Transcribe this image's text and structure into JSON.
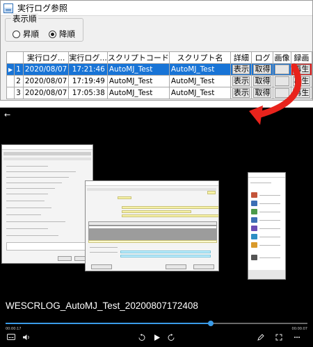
{
  "dialog": {
    "title": "実行ログ参照",
    "sort_group": {
      "title": "表示順",
      "ascending": "昇順",
      "descending": "降順",
      "selected": "descending"
    },
    "table": {
      "headers": [
        "",
        "実行ログ...",
        "実行ログ...",
        "スクリプトコード",
        "スクリプト名",
        "詳細",
        "ログ",
        "画像",
        "録画"
      ],
      "rows": [
        {
          "indicator": "▶",
          "no": "1",
          "date": "2020/08/07",
          "time": "17:21:46",
          "code": "AutoMJ_Test",
          "name": "AutoMJ_Test",
          "detail": "表示",
          "log": "取得",
          "image": "",
          "video": "再生",
          "selected": true
        },
        {
          "indicator": "",
          "no": "2",
          "date": "2020/08/07",
          "time": "17:19:49",
          "code": "AutoMJ_Test",
          "name": "AutoMJ_Test",
          "detail": "表示",
          "log": "取得",
          "image": "",
          "video": "再生",
          "selected": false
        },
        {
          "indicator": "",
          "no": "3",
          "date": "2020/08/07",
          "time": "17:05:38",
          "code": "AutoMJ_Test",
          "name": "AutoMJ_Test",
          "detail": "表示",
          "log": "取得",
          "image": "",
          "video": "再生",
          "selected": false
        }
      ]
    }
  },
  "colors": {
    "selection": "#1874d6",
    "highlight": "#e01818",
    "arrow": "#e8231c",
    "seek": "#3a9be8"
  },
  "player": {
    "back_icon": "back-arrow-icon",
    "caption": "WESCRLOG_AutoMJ_Test_20200807172408",
    "time_elapsed": "00:00:17",
    "time_total": "00:00:07",
    "progress_fraction": 0.68,
    "controls": {
      "subtitles_icon": "subtitles-icon",
      "volume_icon": "volume-icon",
      "rewind_icon": "rewind-10-icon",
      "play_icon": "play-icon",
      "forward_icon": "forward-30-icon",
      "edit_icon": "edit-pen-icon",
      "fullscreen_icon": "fullscreen-icon",
      "more_icon": "more-icon"
    }
  }
}
